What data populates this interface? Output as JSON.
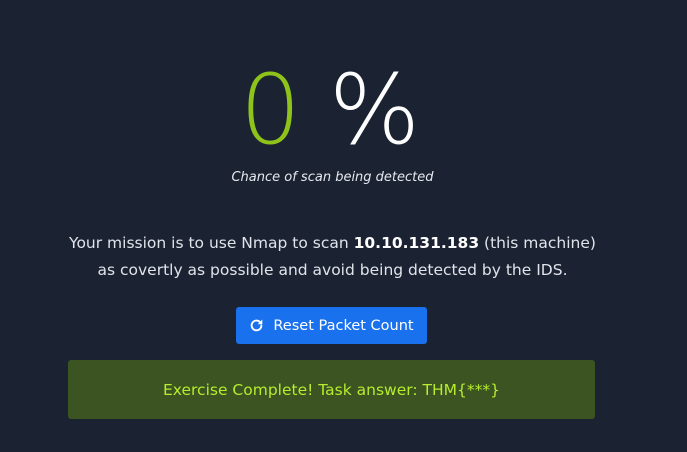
{
  "detection": {
    "value": "0",
    "unit": "%",
    "caption": "Chance of scan being detected"
  },
  "mission": {
    "line1_prefix": "Your mission is to use Nmap to scan ",
    "target_ip": "10.10.131.183",
    "line1_suffix": " (this machine)",
    "line2": "as covertly as possible and avoid being detected by the IDS."
  },
  "actions": {
    "reset_label": "Reset Packet Count",
    "reset_icon": "refresh-icon"
  },
  "status": {
    "message": "Exercise Complete! Task answer: THM{***}"
  },
  "colors": {
    "background": "#1b2232",
    "score_number": "#8ec31a",
    "button": "#1971ee",
    "success_bg": "#3c5421",
    "success_text": "#b7ec2f"
  }
}
